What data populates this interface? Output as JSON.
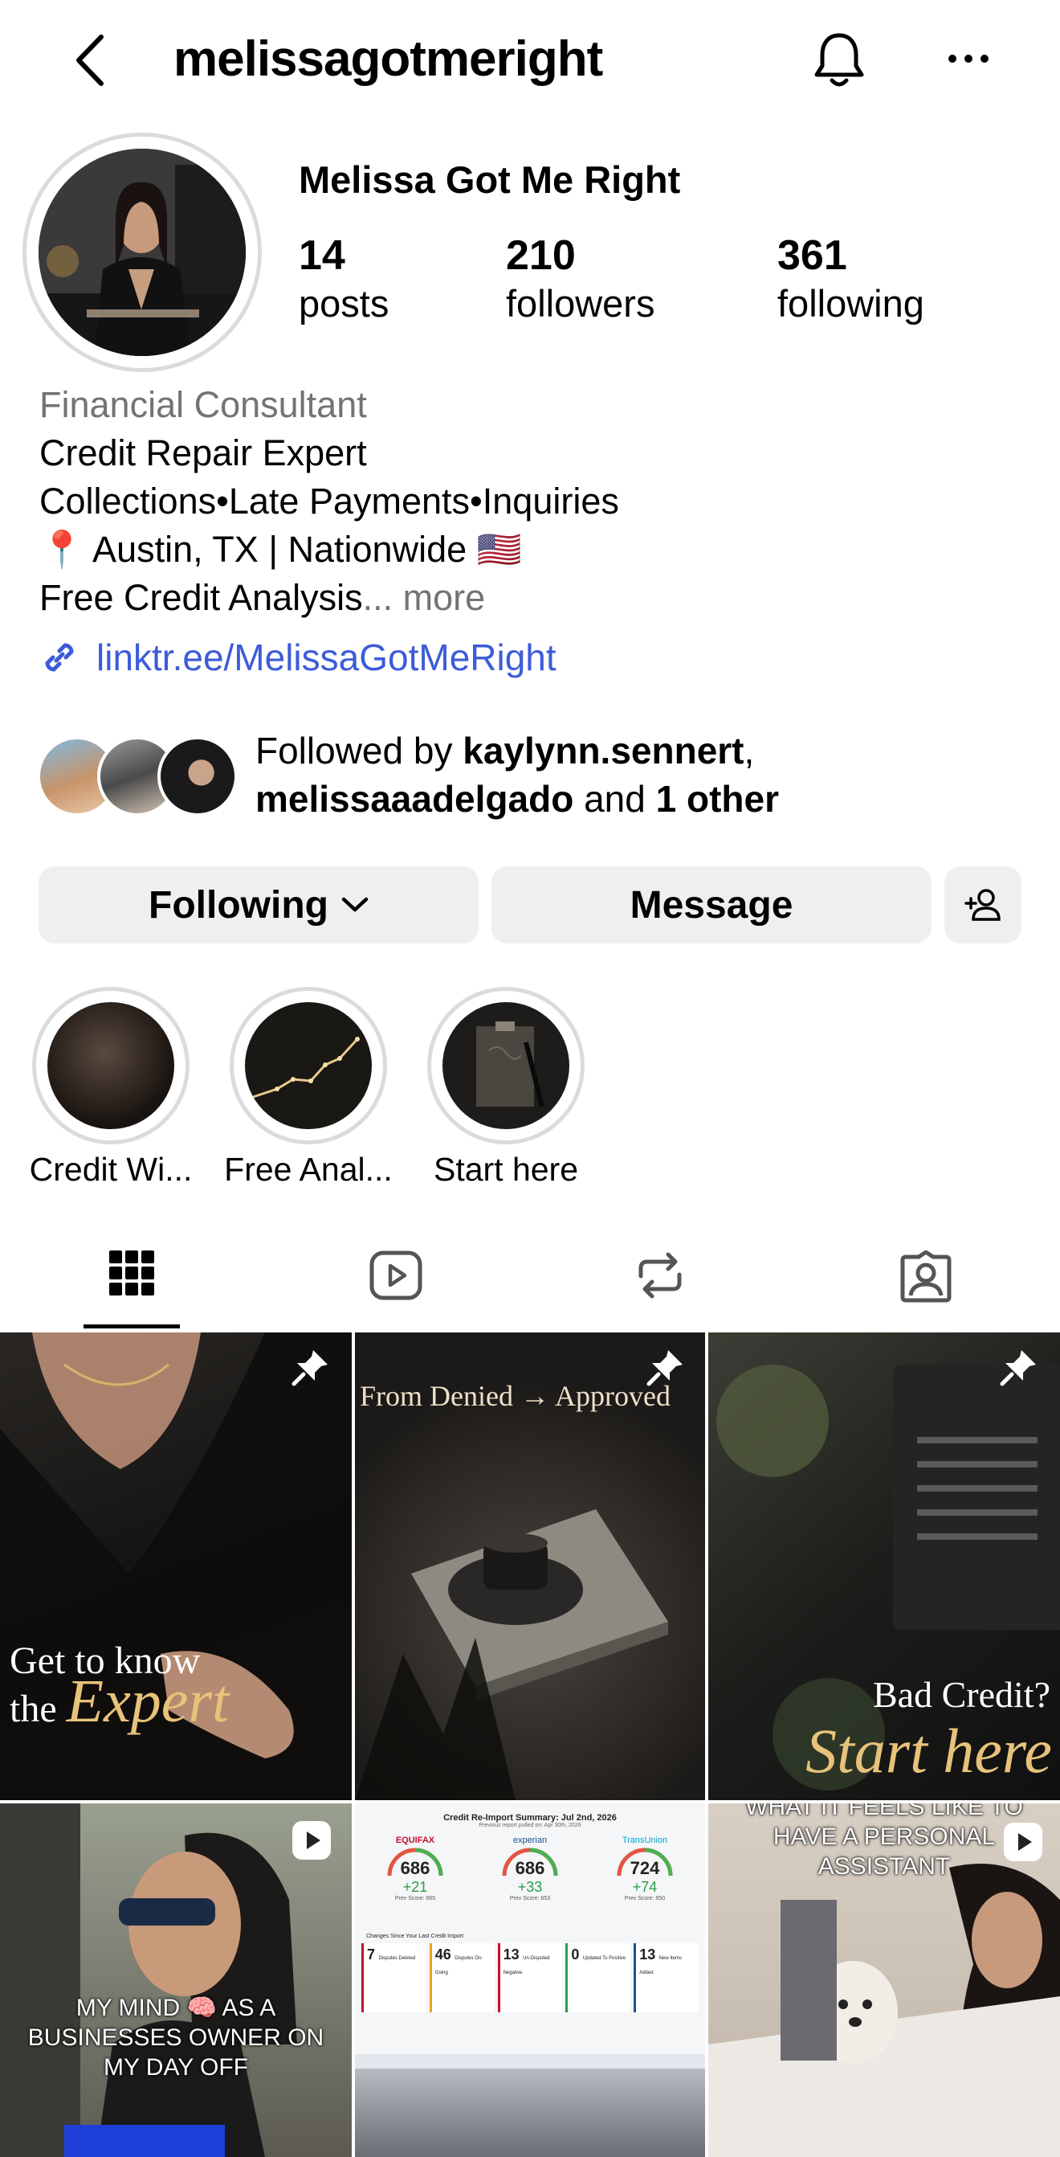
{
  "header": {
    "username": "melissagotmeright",
    "back_icon": "chevron-left-icon",
    "bell_icon": "bell-icon",
    "more_icon": "more-horizontal-icon"
  },
  "profile": {
    "display_name": "Melissa Got Me Right",
    "stats": [
      {
        "value": "14",
        "label": "posts"
      },
      {
        "value": "210",
        "label": "followers"
      },
      {
        "value": "361",
        "label": "following"
      }
    ],
    "category": "Financial Consultant",
    "bio_lines": [
      "Credit Repair Expert",
      "Collections•Late Payments•Inquiries",
      "📍 Austin, TX | Nationwide 🇺🇸",
      "Free Credit Analysis"
    ],
    "bio_more": "... more",
    "link": "linktr.ee/MelissaGotMeRight"
  },
  "followed_by": {
    "prefix": "Followed by ",
    "user1": "kaylynn.sennert",
    "comma": ",",
    "user2": "melissaaadelgado",
    "and": " and ",
    "other": "1 other"
  },
  "actions": {
    "following_label": "Following",
    "message_label": "Message",
    "suggest_icon": "add-person-icon"
  },
  "highlights": [
    {
      "label": "Credit Wi..."
    },
    {
      "label": "Free Anal..."
    },
    {
      "label": "Start here"
    }
  ],
  "tabs": [
    {
      "icon": "grid-icon",
      "active": true
    },
    {
      "icon": "reels-icon",
      "active": false
    },
    {
      "icon": "repost-icon",
      "active": false
    },
    {
      "icon": "tagged-icon",
      "active": false
    }
  ],
  "posts": {
    "p1": {
      "line1": "Get to know",
      "line2a": "the",
      "line2b": "Expert"
    },
    "p2": {
      "line1": "From Denied → Approved"
    },
    "p3": {
      "line1": "Bad Credit?",
      "line2": "Start here"
    },
    "p4": {
      "line1": "MY MIND 🧠 AS A",
      "line2": "BUSINESSES OWNER ON",
      "line3": "MY DAY OFF"
    },
    "p5": {
      "title": "Credit Re-Import Summary: Jul 2nd, 2026",
      "subtitle": "Previous report pulled on: Apr 30th, 2026",
      "bureaus": [
        {
          "name": "EQUIFAX",
          "score": "686",
          "change": "+21",
          "prev": "Prev Score: 665",
          "color": "#c8102e"
        },
        {
          "name": "experian",
          "score": "686",
          "change": "+33",
          "prev": "Prev Score: 653",
          "color": "#1d4f91"
        },
        {
          "name": "TransUnion",
          "score": "724",
          "change": "+74",
          "prev": "Prev Score: 650",
          "color": "#00a6ca"
        }
      ],
      "changes_title": "Changes Since Your Last Credit Import",
      "changes": [
        {
          "num": "7",
          "label": "Disputes Deleted"
        },
        {
          "num": "46",
          "label": "Disputes On-Going"
        },
        {
          "num": "13",
          "label": "Un-Disputed Negative"
        },
        {
          "num": "0",
          "label": "Updated To Positive"
        },
        {
          "num": "13",
          "label": "New Items Added"
        }
      ]
    },
    "p6": {
      "line1": "WHAT IT FEELS LIKE TO",
      "line2": "HAVE A PERSONAL",
      "line3": "ASSISTANT"
    }
  },
  "colors": {
    "link": "#3d5bd9",
    "category": "#737373",
    "button_bg": "#efeff1",
    "ring": "#dbdbdb"
  }
}
